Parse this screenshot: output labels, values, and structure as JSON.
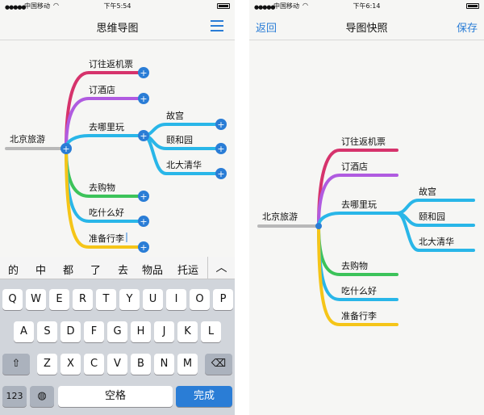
{
  "left": {
    "status": {
      "carrier": "中国移动",
      "time": "下午5:54"
    },
    "nav": {
      "title": "思维导图",
      "menu_icon": "hamburger-menu-icon"
    },
    "map": {
      "root": "北京旅游",
      "branches": [
        "订往返机票",
        "订酒店",
        "去哪里玩",
        "去购物",
        "吃什么好",
        "准备行李"
      ],
      "sub": [
        "故宫",
        "颐和园",
        "北大清华"
      ]
    },
    "candidates": [
      "的",
      "中",
      "都",
      "了",
      "去",
      "物品",
      "托运"
    ],
    "keyboard": {
      "row1": [
        "Q",
        "W",
        "E",
        "R",
        "T",
        "Y",
        "U",
        "I",
        "O",
        "P"
      ],
      "row2": [
        "A",
        "S",
        "D",
        "F",
        "G",
        "H",
        "J",
        "K",
        "L"
      ],
      "row3": [
        "Z",
        "X",
        "C",
        "V",
        "B",
        "N",
        "M"
      ],
      "num_label": "123",
      "space_label": "空格",
      "done_label": "完成"
    }
  },
  "right": {
    "status": {
      "carrier": "中国移动",
      "time": "下午6:14"
    },
    "nav": {
      "back": "返回",
      "title": "导图快照",
      "save": "保存"
    },
    "map": {
      "root": "北京旅游",
      "branches": [
        "订往返机票",
        "订酒店",
        "去哪里玩",
        "去购物",
        "吃什么好",
        "准备行李"
      ],
      "sub": [
        "故宫",
        "颐和园",
        "北大清华"
      ]
    }
  },
  "colors": {
    "accent": "#2a7dd6",
    "branch": [
      "#d6336c",
      "#b05be0",
      "#29b6e8",
      "#3cc35a",
      "#29b6e8",
      "#f5c518"
    ],
    "root_line": "#b8b8b8"
  }
}
